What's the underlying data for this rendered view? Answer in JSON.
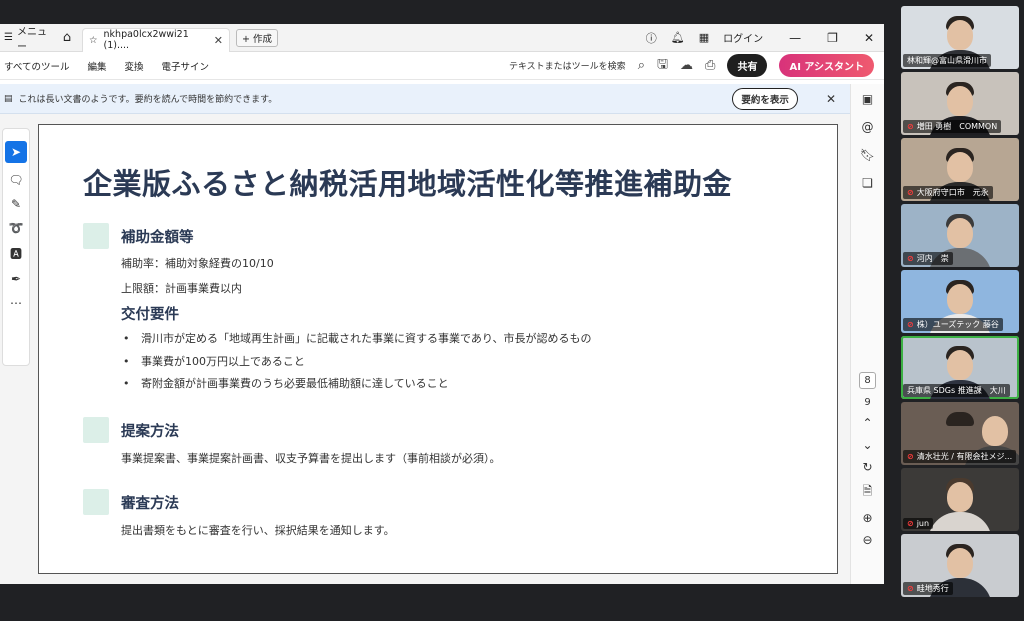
{
  "titlebar": {
    "menu_label": "メニュー",
    "tab_title": "nkhpa0lcx2wwi21 (1)....",
    "new_tab_label": "作成",
    "login_label": "ログイン"
  },
  "toolbar": {
    "items": [
      "すべてのツール",
      "編集",
      "変換",
      "電子サイン"
    ],
    "search_placeholder": "テキストまたはツールを検索",
    "share_label": "共有",
    "ai_label": "AI アシスタント",
    "colors": {
      "share": "#1f1f1f",
      "ai": "#e0245e"
    }
  },
  "infobar": {
    "message": "これは長い文書のようです。要約を読んで時間を節約できます。",
    "summary_button": "要約を表示"
  },
  "document": {
    "title": "企業版ふるさと納税活用地域活性化等推進補助金",
    "section1": {
      "heading": "補助金額等",
      "rate": "補助率：補助対象経費の10/10",
      "limit": "上限額：計画事業費以内"
    },
    "section1b": {
      "heading": "交付要件",
      "bullets": [
        "滑川市が定める「地域再生計画」に記載された事業に資する事業であり、市長が認めるもの",
        "事業費が100万円以上であること",
        "寄附金額が計画事業費のうち必要最低補助額に達していること"
      ]
    },
    "section2": {
      "heading": "提案方法",
      "text": "事業提案書、事業提案計画書、収支予算書を提出します（事前相談が必須）。"
    },
    "section3": {
      "heading": "審査方法",
      "text": "提出書類をもとに審査を行い、採択結果を通知します。"
    },
    "accent_color": "#2b3a55",
    "marker_color": "#dcefe8"
  },
  "pager": {
    "current": "8",
    "next": "9"
  },
  "participants": [
    {
      "name": "林和輝@富山県滑川市"
    },
    {
      "name": "増田 勇樹　COMMON"
    },
    {
      "name": "大阪府守口市　元永"
    },
    {
      "name": "河内　崇"
    },
    {
      "name": "株）ユーズテック 藤谷"
    },
    {
      "name": "兵庫県 SDGs 推進課　大川"
    },
    {
      "name": "清水壮光 / 有限会社メジ..."
    },
    {
      "name": "jun"
    },
    {
      "name": "畦地秀行"
    }
  ]
}
